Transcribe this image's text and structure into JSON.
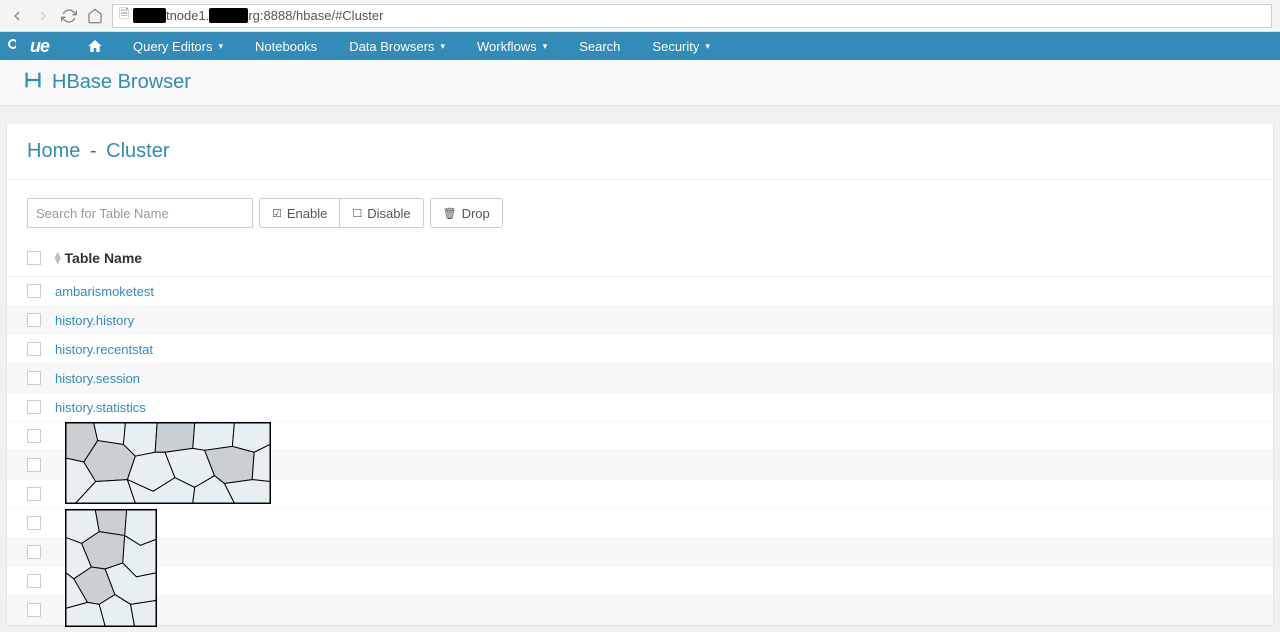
{
  "browser": {
    "url_visible_part1": "tnode1.",
    "url_visible_part2": "rg:8888/hbase/#Cluster"
  },
  "nav": {
    "query_editors": "Query Editors",
    "notebooks": "Notebooks",
    "data_browsers": "Data Browsers",
    "workflows": "Workflows",
    "search": "Search",
    "security": "Security"
  },
  "page": {
    "app_title": "HBase Browser",
    "breadcrumb_home": "Home",
    "breadcrumb_cluster": "Cluster"
  },
  "toolbar": {
    "search_placeholder": "Search for Table Name",
    "enable": "Enable",
    "disable": "Disable",
    "drop": "Drop"
  },
  "table": {
    "header": "Table Name",
    "rows": [
      "ambarismoketest",
      "history.history",
      "history.recentstat",
      "history.session",
      "history.statistics",
      "",
      "",
      "",
      "",
      "",
      "",
      ""
    ]
  }
}
